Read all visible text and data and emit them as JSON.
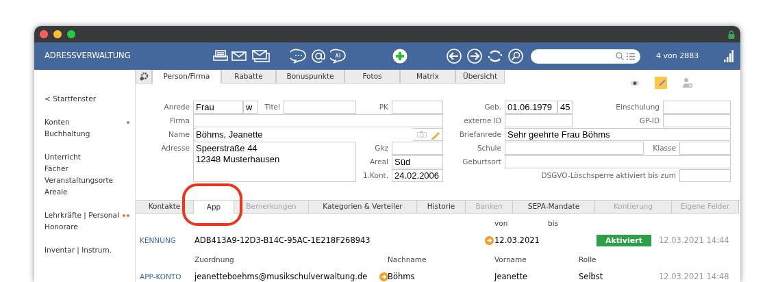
{
  "app_title": "ADRESSVERWALTUNG",
  "record_counter": "4 von 2883",
  "sidebar": {
    "groups": [
      [
        {
          "label": "< Startfenster"
        }
      ],
      [
        {
          "label": "Konten",
          "dots": [
            {
              "color": "#888888"
            }
          ]
        },
        {
          "label": "Buchhaltung"
        }
      ],
      [
        {
          "label": "Unterricht"
        },
        {
          "label": "Fächer"
        },
        {
          "label": "Veranstaltungsorte"
        },
        {
          "label": "Areale"
        }
      ],
      [
        {
          "label": "Lehrkräfte | Personal",
          "dots": [
            {
              "color": "#e8743b"
            },
            {
              "color": "#e8743b"
            }
          ]
        },
        {
          "label": "Honorare"
        }
      ],
      [
        {
          "label": "Inventar | Instrum."
        }
      ]
    ]
  },
  "top_tabs": [
    {
      "label": "Person/Firma",
      "selected": true
    },
    {
      "label": "Rabatte",
      "selected": false
    },
    {
      "label": "Bonuspunkte",
      "selected": false
    },
    {
      "label": "Fotos",
      "selected": false
    },
    {
      "label": "Matrix",
      "selected": false
    },
    {
      "label": "Übersicht",
      "selected": false
    }
  ],
  "person_form": {
    "anrede": {
      "label": "Anrede",
      "value": "Frau",
      "gender": "w"
    },
    "titel": {
      "label": "Titel"
    },
    "pk": {
      "label": "PK"
    },
    "firma": {
      "label": "Firma"
    },
    "name": {
      "label": "Name",
      "value": "Böhms, Jeanette"
    },
    "adresse": {
      "label": "Adresse",
      "value": "Speerstraße 44\n12348 Musterhausen"
    },
    "gkz": {
      "label": "Gkz"
    },
    "areal": {
      "label": "Areal",
      "value": "Süd"
    },
    "erstkontakt": {
      "label": "1.Kont.",
      "value": "24.02.2006"
    },
    "geb": {
      "label": "Geb.",
      "value": "01.06.1979",
      "age": "45"
    },
    "einschulung": {
      "label": "Einschulung"
    },
    "externe_id": {
      "label": "externe ID"
    },
    "gp_id": {
      "label": "GP-ID"
    },
    "briefanrede": {
      "label": "Briefanrede",
      "value": "Sehr geehrte Frau Böhms"
    },
    "schule": {
      "label": "Schule"
    },
    "klasse": {
      "label": "Klasse"
    },
    "geburtsort": {
      "label": "Geburtsort"
    },
    "dsgvo": {
      "label": "DSGVO-Löschsperre aktiviert bis zum"
    }
  },
  "detail_tabs": [
    {
      "label": "Kontakte",
      "selected": false,
      "disabled": false
    },
    {
      "label": "App",
      "selected": true,
      "disabled": false
    },
    {
      "label": "Bemerkungen",
      "selected": false,
      "disabled": true
    },
    {
      "label": "Kategorien & Verteiler",
      "selected": false,
      "disabled": false
    },
    {
      "label": "Historie",
      "selected": false,
      "disabled": false
    },
    {
      "label": "Banken",
      "selected": false,
      "disabled": true
    },
    {
      "label": "SEPA-Mandate",
      "selected": false,
      "disabled": false
    },
    {
      "label": "Kontierung",
      "selected": false,
      "disabled": true
    },
    {
      "label": "Eigene Felder",
      "selected": false,
      "disabled": true
    }
  ],
  "app_panel": {
    "kennung": {
      "label": "KENNUNG",
      "value": "ADB413A9-12D3-B14C-95AC-1E218F268943",
      "von_header": "von",
      "bis_header": "bis",
      "von": "12.03.2021",
      "status": "Aktiviert",
      "timestamp": "12.03.2021 14:44"
    },
    "app_konto": {
      "label": "APP-KONTO",
      "zuordnung_header": "Zuordnung",
      "nachname_header": "Nachname",
      "vorname_header": "Vorname",
      "rolle_header": "Rolle",
      "zuordnung": "jeanetteboehms@musikschulverwaltung.de",
      "nachname": "Böhms",
      "vorname": "Jeanette",
      "rolle": "Selbst",
      "timestamp": "12.03.2021 14:48"
    }
  }
}
